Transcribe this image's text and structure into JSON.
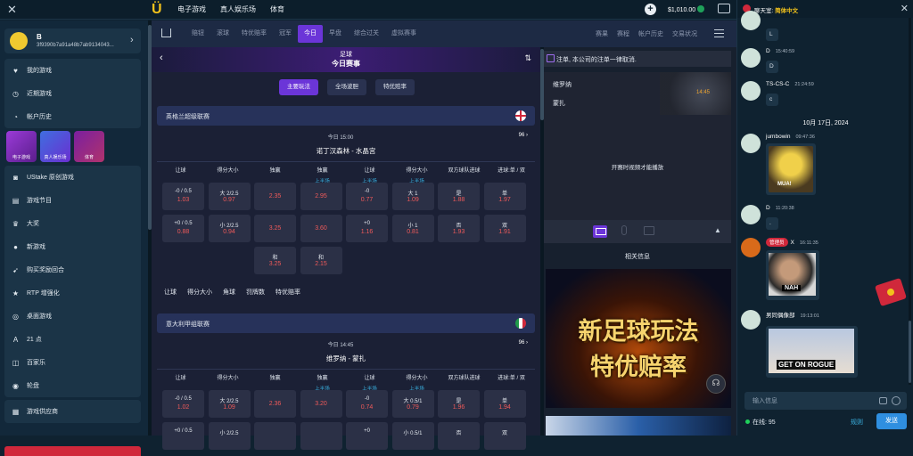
{
  "topbar": {
    "nav": [
      "电子游戏",
      "真人娱乐场",
      "体育"
    ],
    "balance": "$1,010.00"
  },
  "sidebar": {
    "user": {
      "name": "B",
      "address": "3f9390b7a91a48b7ab9134043..."
    },
    "menu1": [
      {
        "icon": "heart-icon",
        "glyph": "♥",
        "label": "我的游戏"
      },
      {
        "icon": "clock-icon",
        "glyph": "◷",
        "label": "近期游戏"
      },
      {
        "icon": "history-icon",
        "glyph": "◔",
        "label": "帐户历史"
      }
    ],
    "tiles": [
      "电子游戏",
      "真人娱乐场",
      "体育"
    ],
    "menu2": [
      {
        "icon": "gamepad-icon",
        "glyph": "◙",
        "label": "UStake 原创游戏"
      },
      {
        "icon": "calendar-icon",
        "glyph": "▤",
        "label": "游戏节目"
      },
      {
        "icon": "trophy-icon",
        "glyph": "♛",
        "label": "大奖"
      },
      {
        "icon": "new-icon",
        "glyph": "●",
        "label": "新游戏"
      },
      {
        "icon": "rocket-icon",
        "glyph": "➹",
        "label": "购买奖励回合"
      },
      {
        "icon": "star-icon",
        "glyph": "★",
        "label": "RTP 增强化"
      },
      {
        "icon": "chip-icon",
        "glyph": "◎",
        "label": "桌面游戏"
      },
      {
        "icon": "cards-icon",
        "glyph": "A",
        "label": "21 点"
      },
      {
        "icon": "baccarat-icon",
        "glyph": "◫",
        "label": "百家乐"
      },
      {
        "icon": "roulette-icon",
        "glyph": "◉",
        "label": "轮盘"
      }
    ],
    "menu3": [
      {
        "icon": "provider-icon",
        "glyph": "▦",
        "label": "游戏供应商"
      }
    ]
  },
  "subnav": {
    "tabs": [
      "赔钮",
      "滚球",
      "特优赔率",
      "冠军",
      "今日",
      "早盘",
      "综合过关",
      "虚拟赛事"
    ],
    "active": 4,
    "right": [
      "赛果",
      "赛程",
      "帐户历史",
      "交易状况"
    ]
  },
  "main": {
    "sport": "足球",
    "title": "今日赛事",
    "pills": [
      "主要玩法",
      "全场波胆",
      "特优赔率"
    ],
    "columns": [
      {
        "label": "让球",
        "sub": ""
      },
      {
        "label": "得分大小",
        "sub": ""
      },
      {
        "label": "独赢",
        "sub": ""
      },
      {
        "label": "独赢",
        "sub": "上半场"
      },
      {
        "label": "让球",
        "sub": "上半场"
      },
      {
        "label": "得分大小",
        "sub": "上半场"
      },
      {
        "label": "双方球队进球",
        "sub": ""
      },
      {
        "label": "进球:单 / 双",
        "sub": ""
      }
    ],
    "leagues": [
      {
        "name": "英格兰超级联赛",
        "time": "今日 15:00",
        "count": "96",
        "teams": "诺丁汉森林 - 水晶宫",
        "rows": [
          [
            {
              "l": "-0 / 0.5",
              "v": "1.03"
            },
            {
              "l": "大 2/2.5",
              "v": "0.97"
            },
            {
              "l": "",
              "v": "2.35"
            },
            {
              "l": "",
              "v": "2.95"
            },
            {
              "l": "-0",
              "v": "0.77"
            },
            {
              "l": "大 1",
              "v": "1.09"
            },
            {
              "l": "是",
              "v": "1.88"
            },
            {
              "l": "单",
              "v": "1.97"
            }
          ],
          [
            {
              "l": "+0 / 0.5",
              "v": "0.88"
            },
            {
              "l": "小 2/2.5",
              "v": "0.94"
            },
            {
              "l": "",
              "v": "3.25"
            },
            {
              "l": "",
              "v": "3.60"
            },
            {
              "l": "+0",
              "v": "1.16"
            },
            {
              "l": "小 1",
              "v": "0.81"
            },
            {
              "l": "否",
              "v": "1.93"
            },
            {
              "l": "双",
              "v": "1.91"
            }
          ]
        ],
        "draw": [
          {
            "l": "和",
            "v": "3.25"
          },
          {
            "l": "和",
            "v": "2.15"
          }
        ],
        "markets": [
          "让球",
          "得分大小",
          "角球",
          "罚牌数",
          "特优赔率"
        ]
      },
      {
        "name": "意大利甲组联赛",
        "time": "今日 14:45",
        "count": "96",
        "teams": "维罗纳 - 蒙扎",
        "rows": [
          [
            {
              "l": "-0 / 0.5",
              "v": "1.02"
            },
            {
              "l": "大 2/2.5",
              "v": "1.09"
            },
            {
              "l": "",
              "v": "2.36"
            },
            {
              "l": "",
              "v": "3.20"
            },
            {
              "l": "-0",
              "v": "0.74"
            },
            {
              "l": "大 0.5/1",
              "v": "0.79"
            },
            {
              "l": "是",
              "v": "1.96"
            },
            {
              "l": "单",
              "v": "1.94"
            }
          ],
          [
            {
              "l": "+0 / 0.5",
              "v": ""
            },
            {
              "l": "小 2/2.5",
              "v": ""
            },
            {
              "l": "",
              "v": ""
            },
            {
              "l": "",
              "v": ""
            },
            {
              "l": "+0",
              "v": ""
            },
            {
              "l": "小 0.5/1",
              "v": ""
            },
            {
              "l": "否",
              "v": ""
            },
            {
              "l": "双",
              "v": ""
            }
          ]
        ]
      }
    ]
  },
  "right": {
    "notice": "注单, 本公司的注单一律取消.",
    "teams": [
      "维罗纳",
      "蒙扎"
    ],
    "match_time": "14:45",
    "video_msg": "开赛时视频才能播放",
    "related": "相关信息",
    "banner": [
      "新足球玩法",
      "特优赔率"
    ]
  },
  "chat": {
    "title_prefix": "聊天室:",
    "title_lang": "简体中文",
    "messages": [
      {
        "name": "",
        "time": "",
        "text": "L"
      },
      {
        "name": "D",
        "time": "15:40:59",
        "text": "D"
      },
      {
        "name": "TS-CS-C",
        "time": "21:24:59",
        "text": "c"
      },
      {
        "name": "jumbowin",
        "time": "09:47:36",
        "text": "MUA!"
      },
      {
        "name": "D",
        "time": "11:20:38",
        "text": "."
      },
      {
        "name": "X",
        "badge": "管理员",
        "time": "16:11:35",
        "text": "NAH"
      },
      {
        "name": "男同偶像部",
        "time": "19:13:01",
        "text": "GET ON ROGUE"
      }
    ],
    "date": "10月 17日, 2024",
    "input_placeholder": "输入信息",
    "online": "在线: 95",
    "rules": "规则",
    "send": "发送"
  },
  "colors": {
    "accent": "#6b35d8",
    "odds": "#ef5a5a",
    "brand": "#f2c21b"
  }
}
